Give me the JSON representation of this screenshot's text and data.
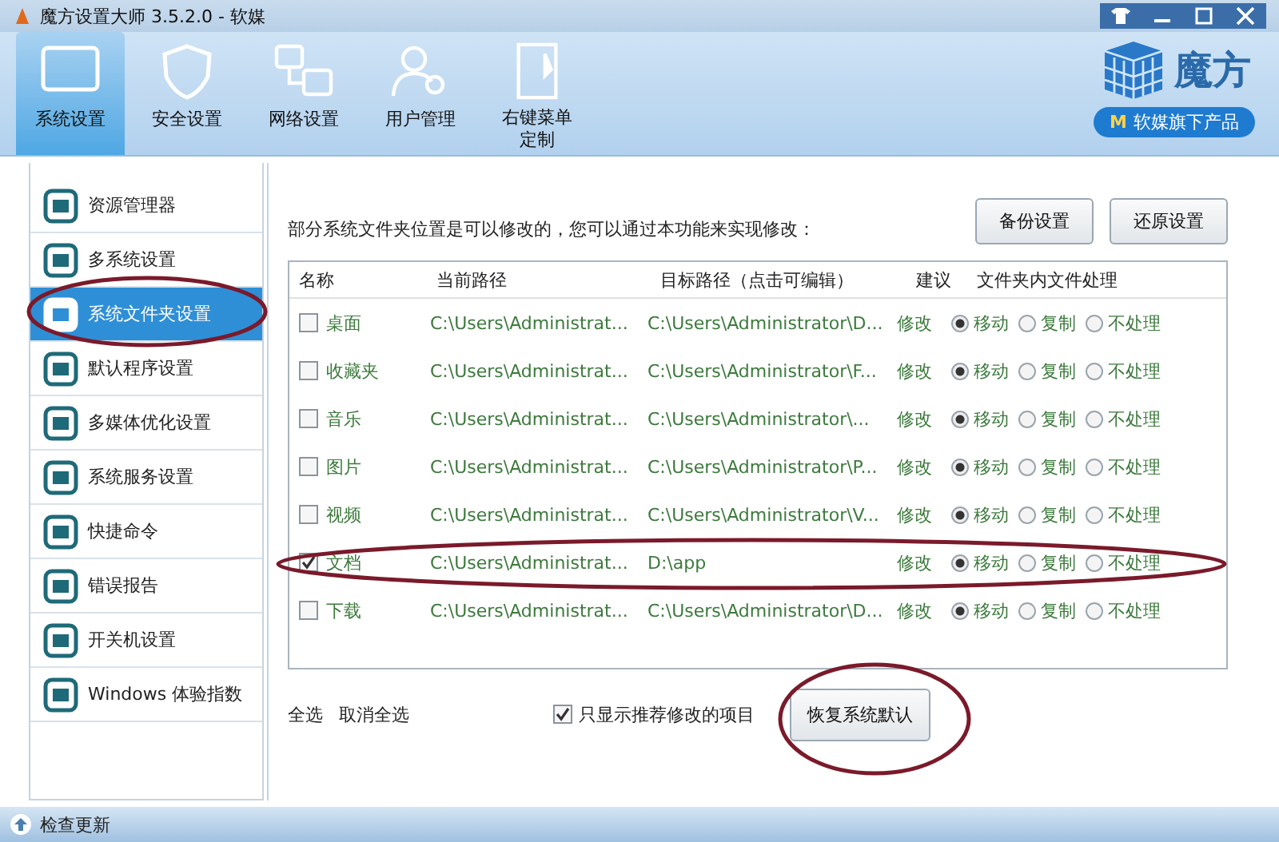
{
  "window": {
    "title": "魔方设置大师 3.5.2.0 - 软媒"
  },
  "toolbar": {
    "tabs": [
      {
        "label": "系统设置",
        "selected": true
      },
      {
        "label": "安全设置",
        "selected": false
      },
      {
        "label": "网络设置",
        "selected": false
      },
      {
        "label": "用户管理",
        "selected": false
      },
      {
        "label": "右键菜单定制",
        "selected": false
      }
    ]
  },
  "brand": {
    "logo_text": "魔方",
    "badge_mark": "M",
    "badge": "软媒旗下产品"
  },
  "sidebar": {
    "items": [
      {
        "label": "资源管理器",
        "selected": false
      },
      {
        "label": "多系统设置",
        "selected": false
      },
      {
        "label": "系统文件夹设置",
        "selected": true
      },
      {
        "label": "默认程序设置",
        "selected": false
      },
      {
        "label": "多媒体优化设置",
        "selected": false
      },
      {
        "label": "系统服务设置",
        "selected": false
      },
      {
        "label": "快捷命令",
        "selected": false
      },
      {
        "label": "错误报告",
        "selected": false
      },
      {
        "label": "开关机设置",
        "selected": false
      },
      {
        "label": "Windows 体验指数",
        "selected": false
      }
    ]
  },
  "content": {
    "description": "部分系统文件夹位置是可以修改的，您可以通过本功能来实现修改：",
    "buttons": [
      "备份设置",
      "还原设置"
    ],
    "table": {
      "columns": [
        "名称",
        "当前路径",
        "目标路径（点击可编辑）",
        "建议",
        "文件夹内文件处理"
      ],
      "rows": [
        {
          "checked": false,
          "name": "桌面",
          "current_path": "C:\\Users\\Administrat...",
          "target_path": "C:\\Users\\Administrator\\D...",
          "suggestion": "修改",
          "options": [
            {
              "label": "移动",
              "selected": true
            },
            {
              "label": "复制",
              "selected": false
            },
            {
              "label": "不处理",
              "selected": false
            }
          ]
        },
        {
          "checked": false,
          "name": "收藏夹",
          "current_path": "C:\\Users\\Administrat...",
          "target_path": "C:\\Users\\Administrator\\F...",
          "suggestion": "修改",
          "options": [
            {
              "label": "移动",
              "selected": true
            },
            {
              "label": "复制",
              "selected": false
            },
            {
              "label": "不处理",
              "selected": false
            }
          ]
        },
        {
          "checked": false,
          "name": "音乐",
          "current_path": "C:\\Users\\Administrat...",
          "target_path": "C:\\Users\\Administrator\\...",
          "suggestion": "修改",
          "options": [
            {
              "label": "移动",
              "selected": true
            },
            {
              "label": "复制",
              "selected": false
            },
            {
              "label": "不处理",
              "selected": false
            }
          ]
        },
        {
          "checked": false,
          "name": "图片",
          "current_path": "C:\\Users\\Administrat...",
          "target_path": "C:\\Users\\Administrator\\P...",
          "suggestion": "修改",
          "options": [
            {
              "label": "移动",
              "selected": true
            },
            {
              "label": "复制",
              "selected": false
            },
            {
              "label": "不处理",
              "selected": false
            }
          ]
        },
        {
          "checked": false,
          "name": "视频",
          "current_path": "C:\\Users\\Administrat...",
          "target_path": "C:\\Users\\Administrator\\V...",
          "suggestion": "修改",
          "options": [
            {
              "label": "移动",
              "selected": true
            },
            {
              "label": "复制",
              "selected": false
            },
            {
              "label": "不处理",
              "selected": false
            }
          ]
        },
        {
          "checked": true,
          "name": "文档",
          "current_path": "C:\\Users\\Administrat...",
          "target_path": "D:\\app",
          "suggestion": "修改",
          "options": [
            {
              "label": "移动",
              "selected": true
            },
            {
              "label": "复制",
              "selected": false
            },
            {
              "label": "不处理",
              "selected": false
            }
          ]
        },
        {
          "checked": false,
          "name": "下载",
          "current_path": "C:\\Users\\Administrat...",
          "target_path": "C:\\Users\\Administrator\\D...",
          "suggestion": "修改",
          "options": [
            {
              "label": "移动",
              "selected": true
            },
            {
              "label": "复制",
              "selected": false
            },
            {
              "label": "不处理",
              "selected": false
            }
          ]
        }
      ]
    },
    "select_all": "全选",
    "deselect_all": "取消全选",
    "filter": {
      "label": "只显示推荐修改的项目",
      "checked": true
    },
    "restore_button": "恢复系统默认"
  },
  "status_bar": {
    "update": "检查更新"
  }
}
